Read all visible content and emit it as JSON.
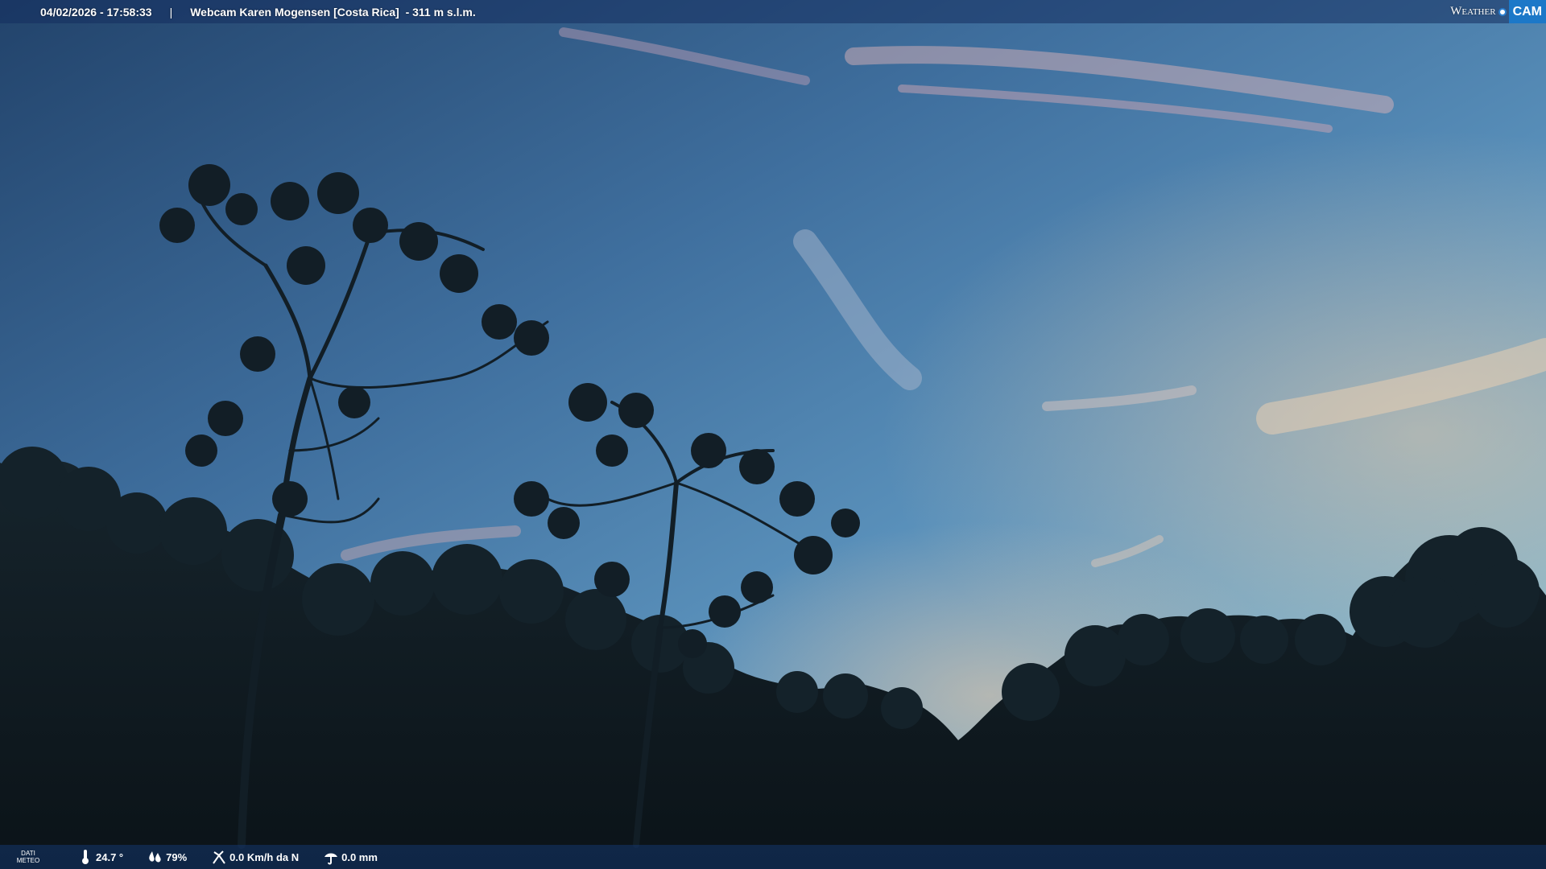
{
  "overlay": {
    "datetime": "04/02/2026 - 17:58:33",
    "separator": "|",
    "title": "Webcam Karen Mogensen [Costa Rica]  - 311 m s.l.m."
  },
  "logo": {
    "weather": "Weather",
    "cam": "CAM"
  },
  "weather_data": {
    "label_line1": "DATI",
    "label_line2": "METEO",
    "temperature": "24.7 °",
    "humidity": "79%",
    "wind": "0.0 Km/h da N",
    "rain": "0.0 mm"
  },
  "icons": {
    "temperature": "thermometer-icon",
    "humidity": "humidity-drops-icon",
    "wind": "wind-icon",
    "rain": "rain-icon"
  },
  "colors": {
    "sky_top": "#2c4f77",
    "sky_mid": "#4f86b8",
    "sky_horizon": "#8cc2d9",
    "vegetation": "#0f1a20",
    "overlay_bar": "#14376e",
    "logo_blue": "#1c78c8"
  }
}
